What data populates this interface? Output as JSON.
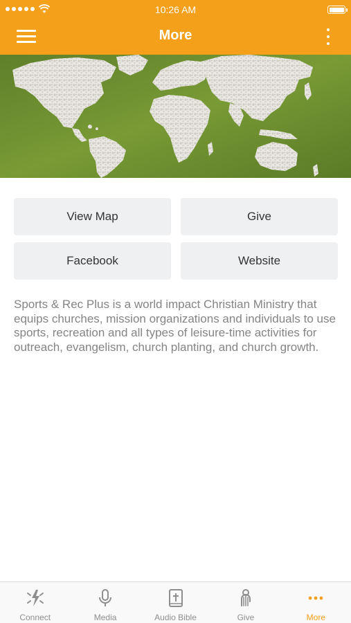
{
  "status_bar": {
    "time": "10:26 AM"
  },
  "header": {
    "title": "More"
  },
  "buttons": [
    {
      "label": "View Map"
    },
    {
      "label": "Give"
    },
    {
      "label": "Facebook"
    },
    {
      "label": "Website"
    }
  ],
  "description": "Sports & Rec Plus is a world impact Christian Ministry that equips churches, mission organizations and individuals to use sports, recreation and all types of leisure-time activities for outreach, evangelism, church planting, and church growth.",
  "tabs": [
    {
      "label": "Connect",
      "icon": "connect-icon"
    },
    {
      "label": "Media",
      "icon": "microphone-icon"
    },
    {
      "label": "Audio Bible",
      "icon": "bible-icon"
    },
    {
      "label": "Give",
      "icon": "give-icon"
    },
    {
      "label": "More",
      "icon": "more-dots-icon",
      "active": true
    }
  ],
  "colors": {
    "accent": "#f5a01a",
    "grass": "#6f8f2f",
    "tab_inactive": "#8e8e8e"
  }
}
